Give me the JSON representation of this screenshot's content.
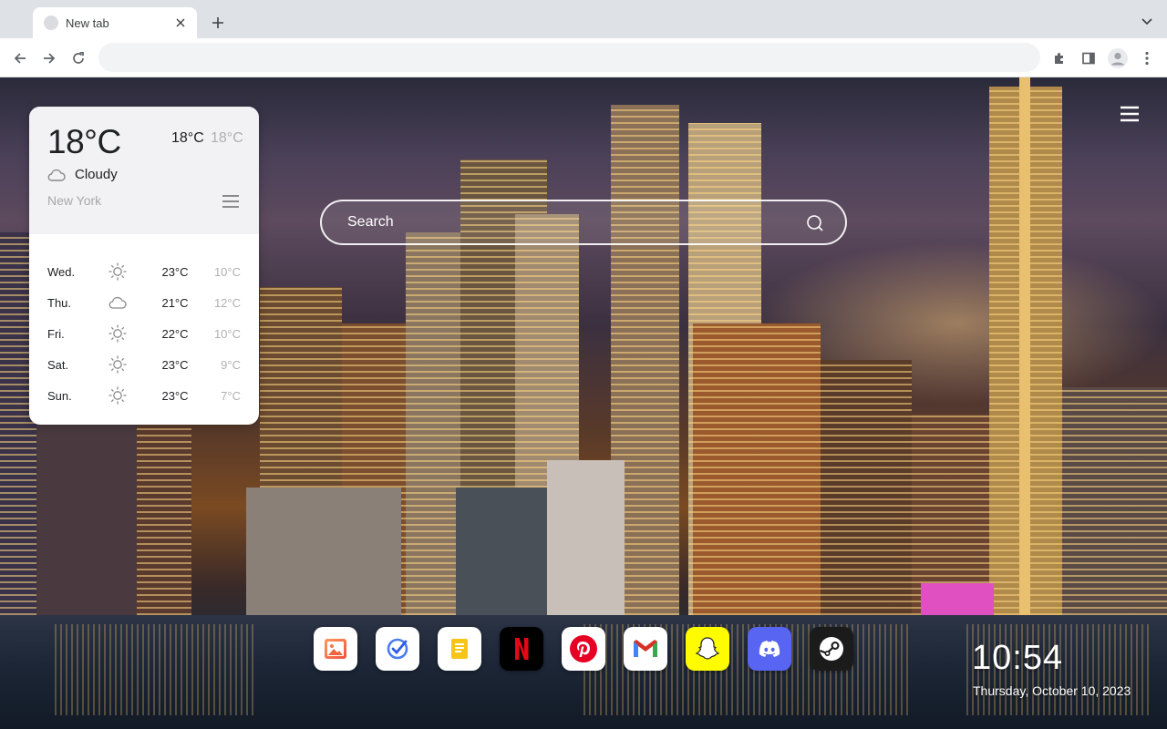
{
  "browser": {
    "tab": {
      "title": "New tab"
    },
    "omnibox": {
      "value": "",
      "placeholder": ""
    }
  },
  "weather": {
    "current_temp": "18°C",
    "high": "18°C",
    "low": "18°C",
    "condition": "Cloudy",
    "condition_icon": "cloud-icon",
    "city": "New York",
    "forecast": [
      {
        "day": "Wed.",
        "icon": "sun-icon",
        "high": "23°C",
        "low": "10°C"
      },
      {
        "day": "Thu.",
        "icon": "cloud-icon",
        "high": "21°C",
        "low": "12°C"
      },
      {
        "day": "Fri.",
        "icon": "sun-icon",
        "high": "22°C",
        "low": "10°C"
      },
      {
        "day": "Sat.",
        "icon": "sun-icon",
        "high": "23°C",
        "low": "9°C"
      },
      {
        "day": "Sun.",
        "icon": "sun-icon",
        "high": "23°C",
        "low": "7°C"
      }
    ]
  },
  "search": {
    "placeholder": "Search"
  },
  "dock": {
    "apps": [
      {
        "name": "photos",
        "icon": "image-icon",
        "bg": "#ffffff"
      },
      {
        "name": "tasks",
        "icon": "check-icon",
        "bg": "#ffffff"
      },
      {
        "name": "notes",
        "icon": "note-icon",
        "bg": "#ffffff"
      },
      {
        "name": "netflix",
        "icon": "netflix-icon",
        "bg": "#000000",
        "accent": "#e50914"
      },
      {
        "name": "pinterest",
        "icon": "pinterest-icon",
        "bg": "#ffffff",
        "accent": "#e60023"
      },
      {
        "name": "gmail",
        "icon": "gmail-icon",
        "bg": "#ffffff",
        "accent": "#d93025"
      },
      {
        "name": "snapchat",
        "icon": "snapchat-icon",
        "bg": "#fffc00"
      },
      {
        "name": "discord",
        "icon": "discord-icon",
        "bg": "#5865f2"
      },
      {
        "name": "steam",
        "icon": "steam-icon",
        "bg": "#1b1b1b"
      }
    ]
  },
  "clock": {
    "time": "10:54",
    "date": "Thursday, October 10, 2023"
  }
}
